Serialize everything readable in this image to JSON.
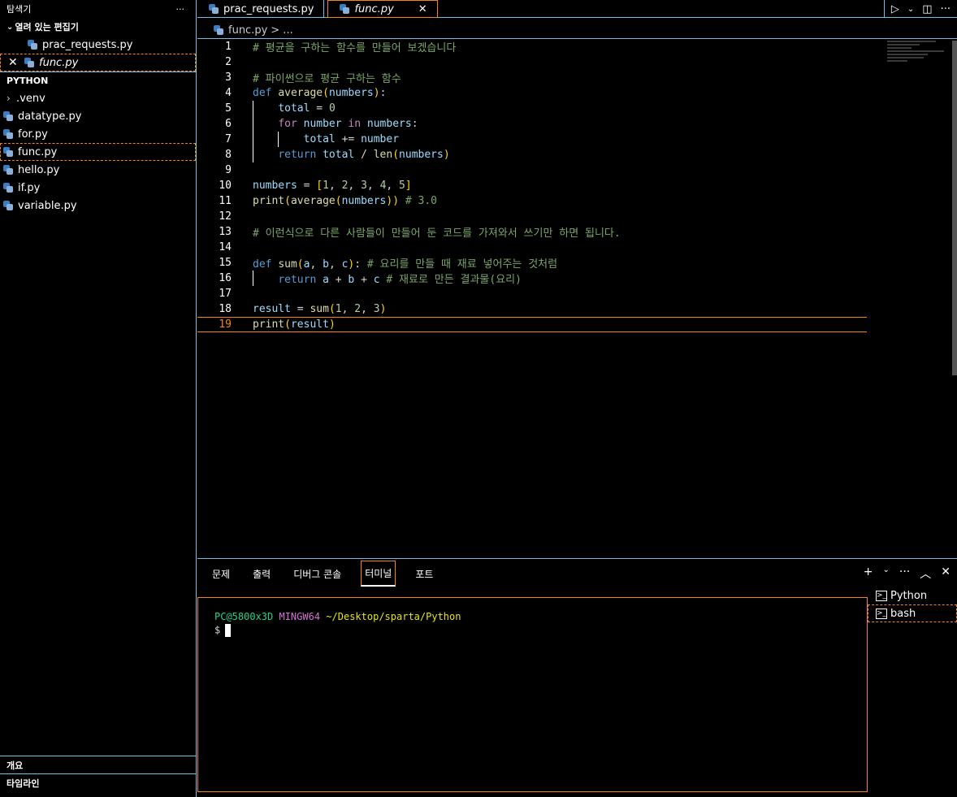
{
  "sidebar": {
    "title": "탐색기",
    "more": "···",
    "open_editors_label": "열려 있는 편집기",
    "open_editors": [
      {
        "name": "prac_requests.py",
        "active": false
      },
      {
        "name": "func.py",
        "active": true
      }
    ],
    "project_label": "PYTHON",
    "tree": [
      {
        "name": ".venv",
        "folder": true
      },
      {
        "name": "datatype.py"
      },
      {
        "name": "for.py"
      },
      {
        "name": "func.py",
        "focused": true
      },
      {
        "name": "hello.py"
      },
      {
        "name": "if.py"
      },
      {
        "name": "variable.py"
      }
    ],
    "outline_label": "개요",
    "timeline_label": "타임라인"
  },
  "tabs": [
    {
      "name": "prac_requests.py",
      "active": false
    },
    {
      "name": "func.py",
      "active": true,
      "close": "✕"
    }
  ],
  "breadcrumb": {
    "file": "func.py",
    "rest": "> ..."
  },
  "editor": {
    "current_line": 19,
    "lines": [
      {
        "n": "1",
        "code": "# 평균을 구하는 함수를 만들어 보겠습니다"
      },
      {
        "n": "2",
        "code": ""
      },
      {
        "n": "3",
        "code": "# 파이썬으로 평균 구하는 함수"
      },
      {
        "n": "4",
        "code": "def average(numbers):"
      },
      {
        "n": "5",
        "code": "    total = 0"
      },
      {
        "n": "6",
        "code": "    for number in numbers:"
      },
      {
        "n": "7",
        "code": "        total += number"
      },
      {
        "n": "8",
        "code": "    return total / len(numbers)"
      },
      {
        "n": "9",
        "code": ""
      },
      {
        "n": "10",
        "code": "numbers = [1, 2, 3, 4, 5]"
      },
      {
        "n": "11",
        "code": "print(average(numbers)) # 3.0"
      },
      {
        "n": "12",
        "code": ""
      },
      {
        "n": "13",
        "code": "# 이런식으로 다른 사람들이 만들어 둔 코드를 가져와서 쓰기만 하면 됩니다."
      },
      {
        "n": "14",
        "code": ""
      },
      {
        "n": "15",
        "code": "def sum(a, b, c): # 요리를 만들 때 재료 넣어주는 것처럼"
      },
      {
        "n": "16",
        "code": "    return a + b + c # 재료로 만든 결과물(요리)"
      },
      {
        "n": "17",
        "code": ""
      },
      {
        "n": "18",
        "code": "result = sum(1, 2, 3)"
      },
      {
        "n": "19",
        "code": "print(result)"
      }
    ]
  },
  "panel": {
    "tabs": [
      "문제",
      "출력",
      "디버그 콘솔",
      "터미널",
      "포트"
    ],
    "active_tab": "터미널",
    "terminal": {
      "user": "PC@5800x3D",
      "shell": "MINGW64",
      "path": "~/Desktop/sparta/Python",
      "prompt": "$"
    },
    "terminals": [
      {
        "name": "Python",
        "focused": false
      },
      {
        "name": "bash",
        "focused": true
      }
    ]
  },
  "colors": {
    "border": "#6fc3df",
    "focus": "#f38518"
  }
}
